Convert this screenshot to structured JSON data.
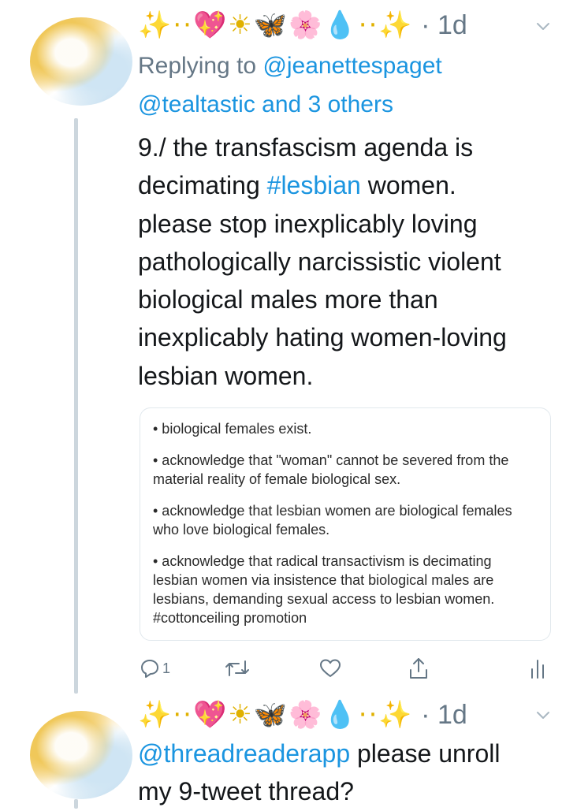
{
  "tweets": [
    {
      "emoji_name": "✨··💖☀🦋🌸💧··✨",
      "time": "· 1d",
      "replying_prefix": "Replying to ",
      "replying_user": "@jeanettespaget",
      "replying_line2_user": "@tealtastic",
      "replying_line2_rest": " and 3 others",
      "text_segments": {
        "line1": "9./ the transfascism agenda is",
        "line2_pre": "decimating ",
        "line2_hashtag": "#lesbian",
        "line2_post": " women.",
        "line3": "please stop inexplicably loving",
        "line4": "pathologically narcissistic violent",
        "line5": "biological males more than",
        "line6": "inexplicably hating women-loving",
        "line7": "lesbian women."
      },
      "card_items": [
        "• biological females exist.",
        "• acknowledge that \"woman\" cannot be severed from the material reality of female biological sex.",
        "• acknowledge that lesbian women are biological females who love biological females.",
        "• acknowledge that radical transactivism is decimating lesbian women via insistence that biological males are lesbians, demanding sexual access to lesbian women. #cottonceiling promotion"
      ],
      "actions": {
        "reply_count": "1"
      }
    },
    {
      "emoji_name": "✨··💖☀🦋🌸💧··✨",
      "time": "· 1d",
      "mention": "@threadreaderapp",
      "text_rest": " please unroll",
      "text_line2": "my 9-tweet thread?"
    }
  ],
  "icons": {
    "reply": "reply-icon",
    "retweet": "retweet-icon",
    "like": "heart-icon",
    "share": "share-icon",
    "analytics": "analytics-icon",
    "caret": "chevron-down-icon"
  },
  "colors": {
    "link": "#1b95e0",
    "secondary": "#657786",
    "thread_line": "#ccd6dd"
  }
}
